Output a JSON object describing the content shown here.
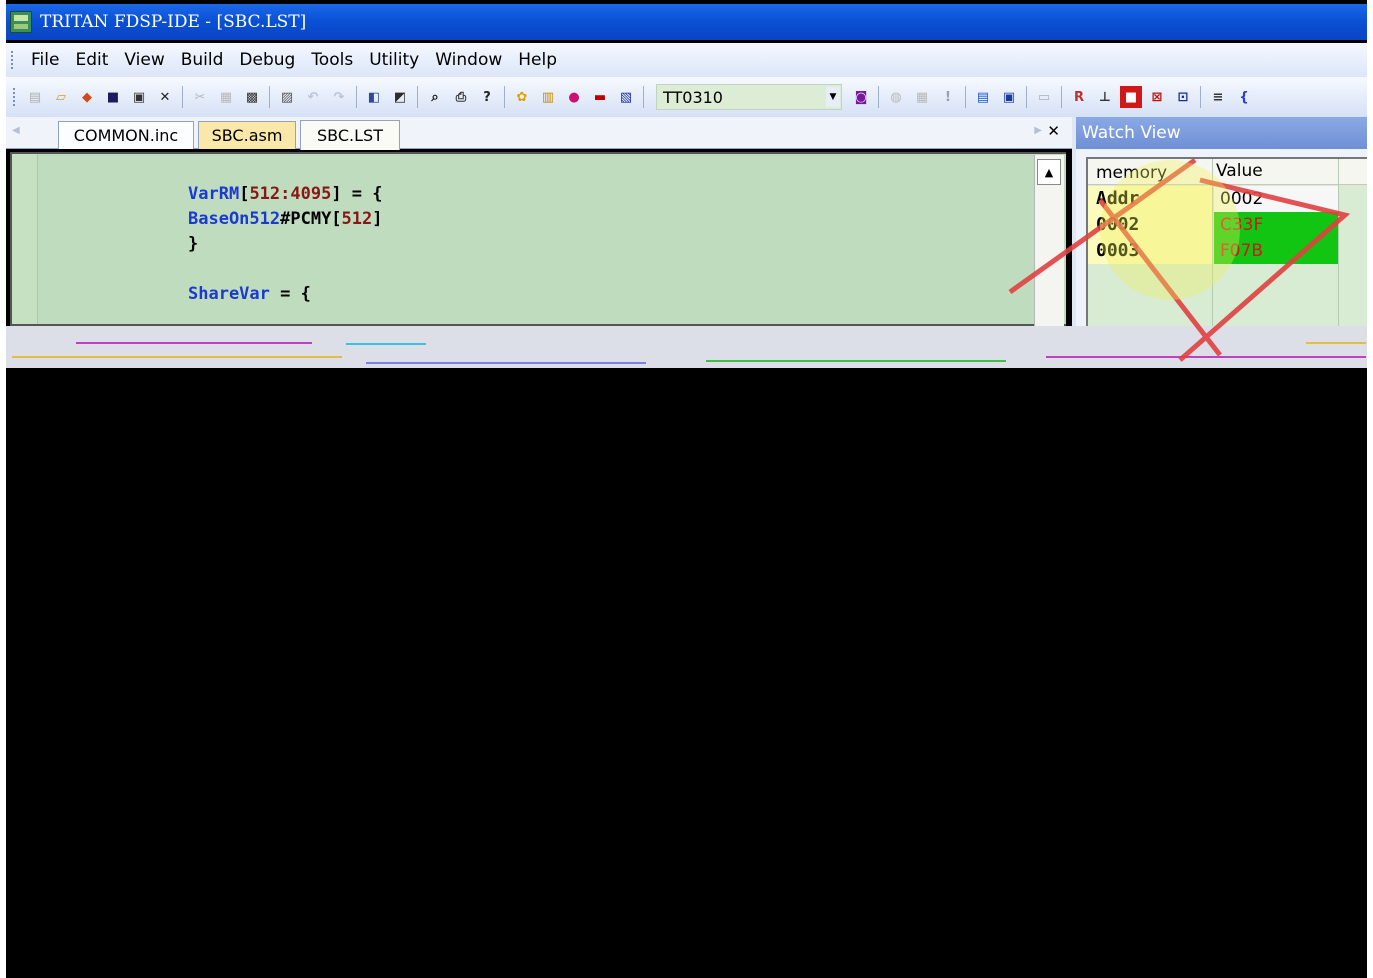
{
  "window": {
    "title": "TRITAN FDSP-IDE  - [SBC.LST]"
  },
  "menu": [
    "File",
    "Edit",
    "View",
    "Build",
    "Debug",
    "Tools",
    "Utility",
    "Window",
    "Help"
  ],
  "toolbar": {
    "target_combo_value": "TT0310"
  },
  "tabs": [
    {
      "label": "COMMON.inc"
    },
    {
      "label": "SBC.asm"
    },
    {
      "label": "SBC.LST"
    }
  ],
  "editor": {
    "lines": [
      {
        "kw": "VarRM",
        "rest1": "[",
        "num": "512:4095",
        "rest2": "] = {"
      },
      {
        "kw": "BaseOn512",
        "rest1": "#PCMY[",
        "num": "512",
        "rest2": "]"
      },
      {
        "text": "}"
      },
      {
        "kw": "ShareVar",
        "rest2": " = {"
      }
    ]
  },
  "watch": {
    "title": "Watch View",
    "col_memory": "memory",
    "col_value": "Value",
    "rows": [
      {
        "addr": "Addr",
        "value": "0002"
      },
      {
        "addr": "0002",
        "value": "C33F"
      },
      {
        "addr": "0003",
        "value": "F07B"
      }
    ]
  },
  "colors": {
    "editor_bg": "#bfdcbf",
    "keyword": "#1a3ad0",
    "number": "#8a1717",
    "watch_highlight": "#12c512"
  }
}
